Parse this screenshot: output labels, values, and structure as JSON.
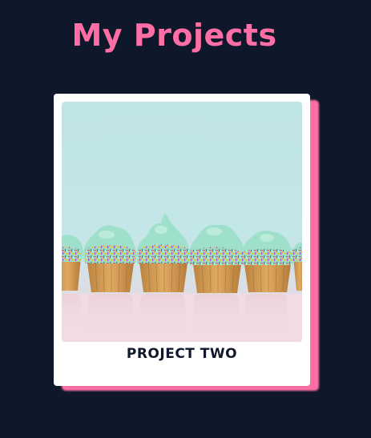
{
  "page": {
    "title": "My Projects"
  },
  "projects": [
    {
      "caption": "PROJECT TWO",
      "image": "cupcakes-photo"
    }
  ],
  "colors": {
    "background": "#0f172a",
    "accent": "#ff6fa6",
    "card": "#ffffff",
    "caption_text": "#0f172a"
  }
}
